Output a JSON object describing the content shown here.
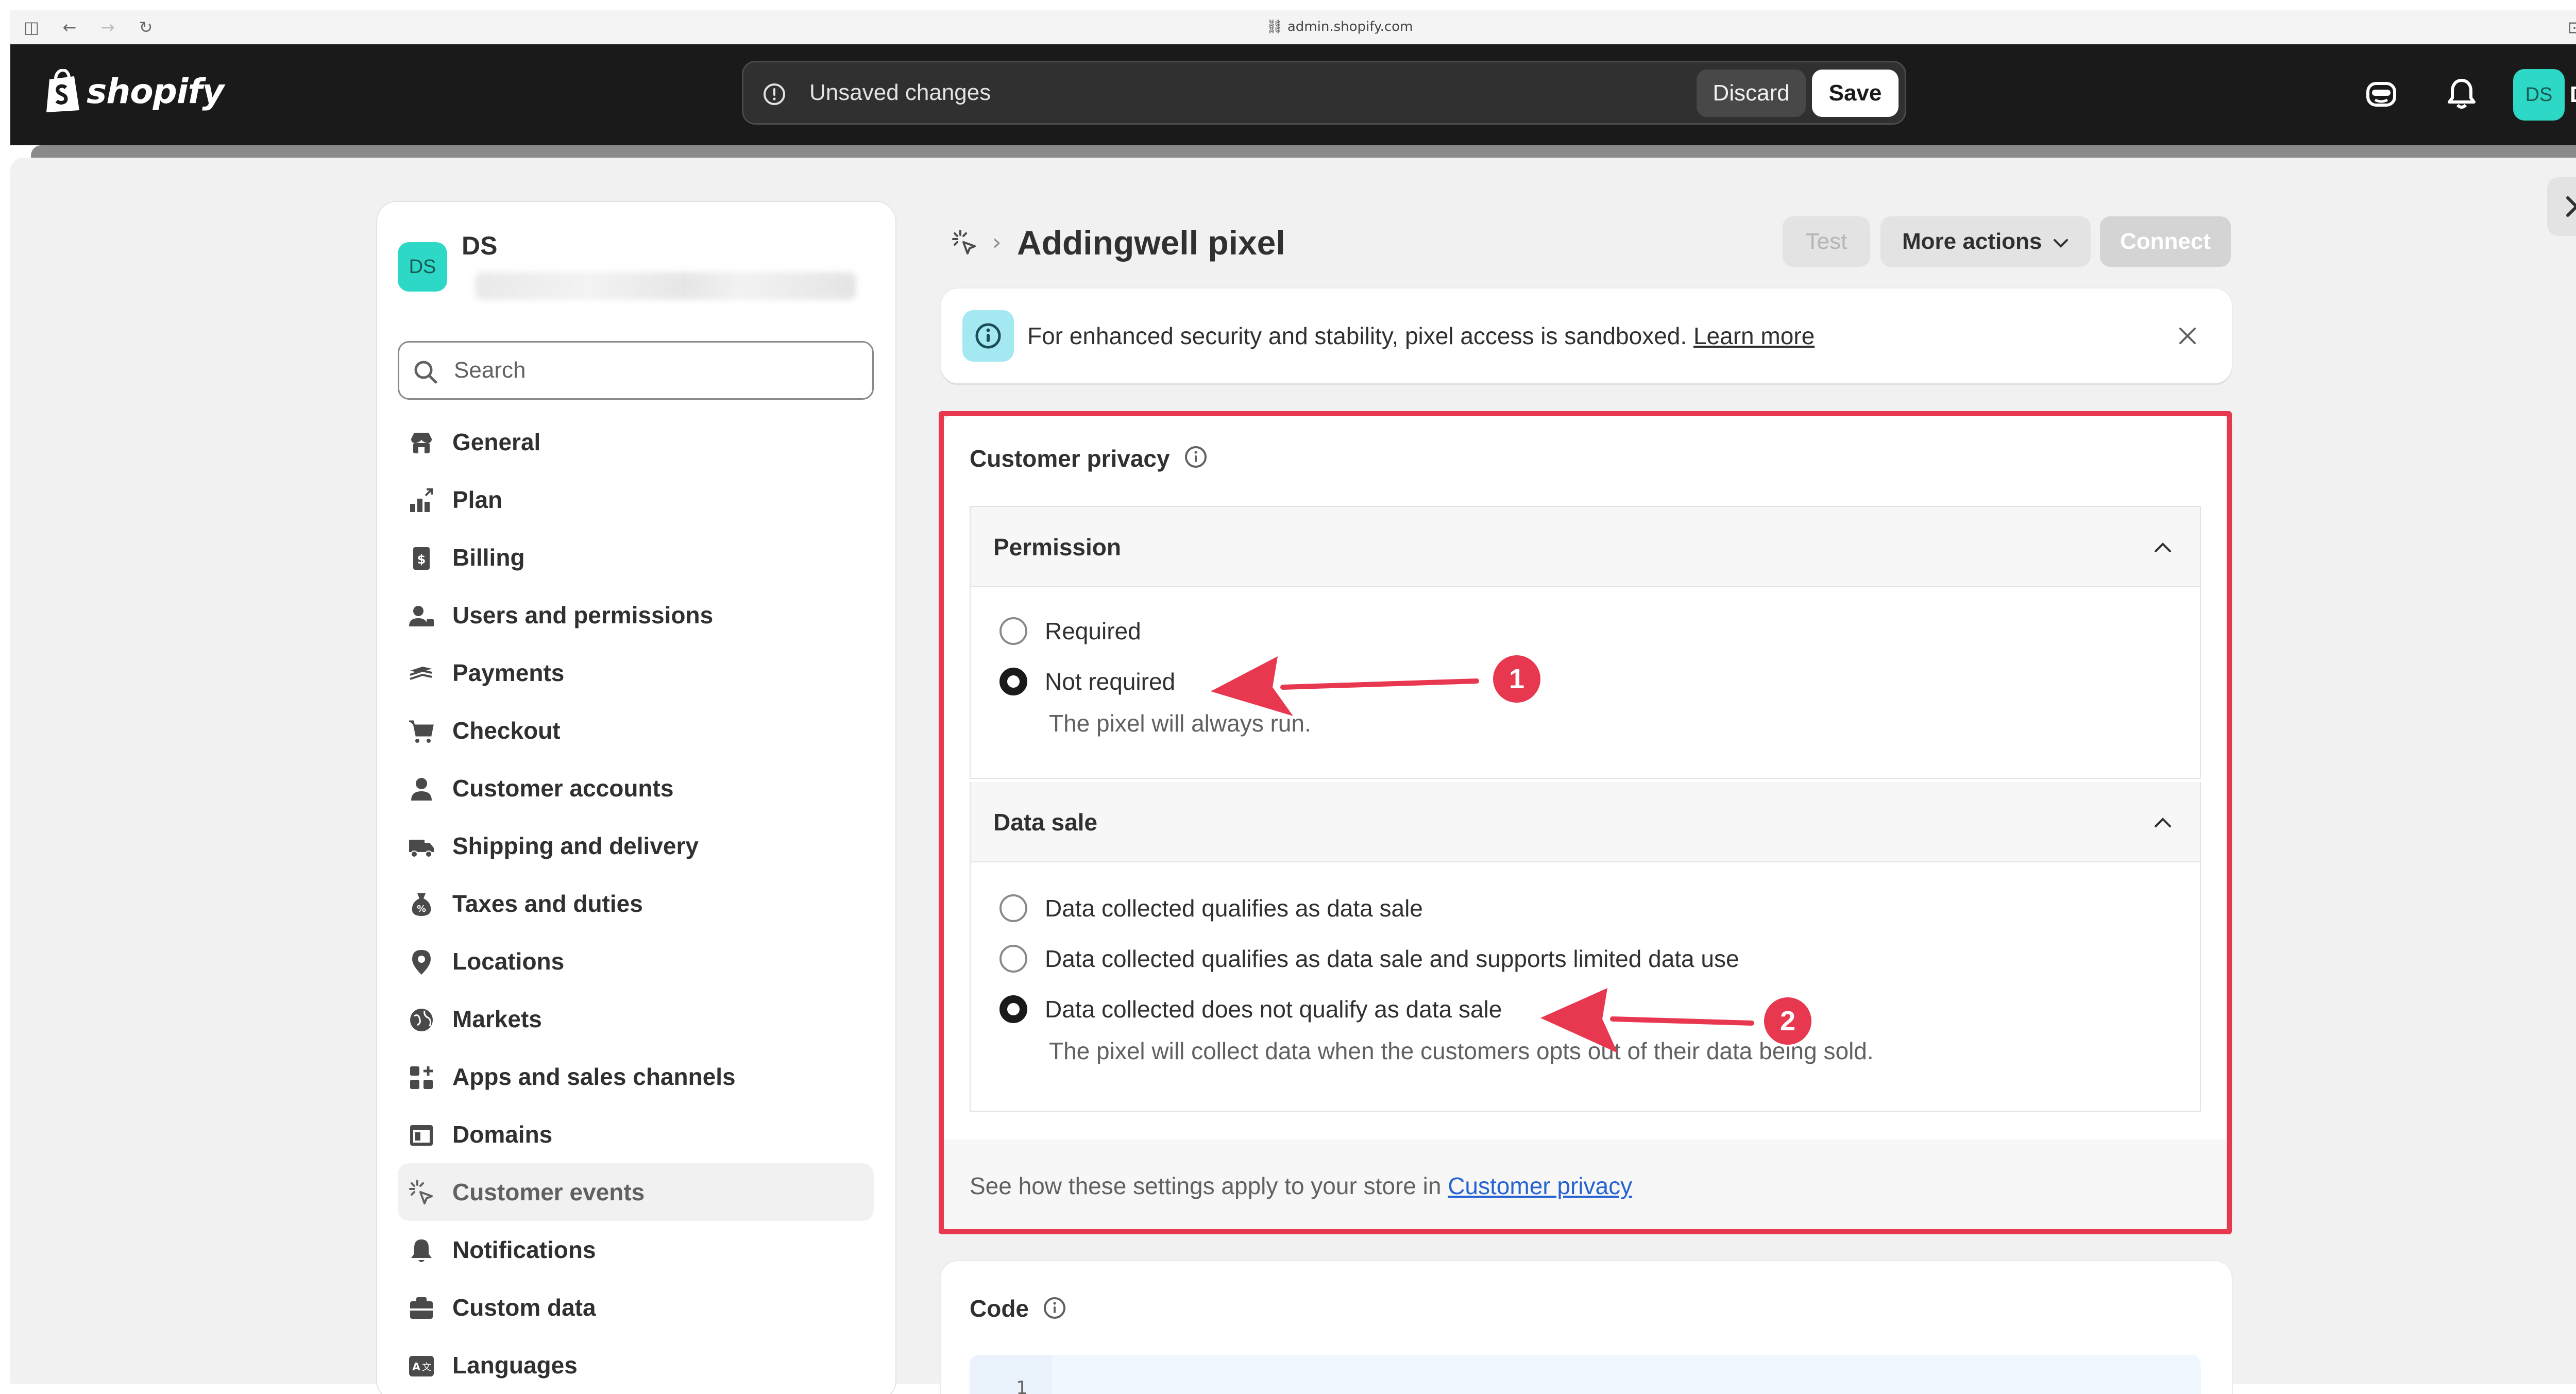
{
  "browser": {
    "url": "admin.shopify.com"
  },
  "topbar": {
    "brand": "shopify",
    "unsaved_message": "Unsaved changes",
    "discard_label": "Discard",
    "save_label": "Save",
    "user_initials": "DS",
    "user_name": "DS"
  },
  "sidebar": {
    "store_initials": "DS",
    "store_name": "DS",
    "search_placeholder": "Search",
    "items": [
      {
        "label": "General",
        "icon": "store-icon"
      },
      {
        "label": "Plan",
        "icon": "plan-icon"
      },
      {
        "label": "Billing",
        "icon": "billing-icon"
      },
      {
        "label": "Users and permissions",
        "icon": "users-icon"
      },
      {
        "label": "Payments",
        "icon": "payments-icon"
      },
      {
        "label": "Checkout",
        "icon": "cart-icon"
      },
      {
        "label": "Customer accounts",
        "icon": "person-icon"
      },
      {
        "label": "Shipping and delivery",
        "icon": "truck-icon"
      },
      {
        "label": "Taxes and duties",
        "icon": "taxes-icon"
      },
      {
        "label": "Locations",
        "icon": "location-icon"
      },
      {
        "label": "Markets",
        "icon": "globe-icon"
      },
      {
        "label": "Apps and sales channels",
        "icon": "apps-icon"
      },
      {
        "label": "Domains",
        "icon": "domains-icon"
      },
      {
        "label": "Customer events",
        "icon": "cursor-click-icon",
        "active": true
      },
      {
        "label": "Notifications",
        "icon": "bell-icon"
      },
      {
        "label": "Custom data",
        "icon": "custom-data-icon"
      },
      {
        "label": "Languages",
        "icon": "languages-icon"
      }
    ]
  },
  "main": {
    "title": "Addingwell pixel",
    "test_label": "Test",
    "more_actions_label": "More actions",
    "connect_label": "Connect",
    "banner": {
      "text": "For enhanced security and stability, pixel access is sandboxed.",
      "link": "Learn more"
    },
    "privacy": {
      "title": "Customer privacy",
      "permission": {
        "title": "Permission",
        "options": [
          "Required",
          "Not required"
        ],
        "selected": "Not required",
        "help": "The pixel will always run."
      },
      "data_sale": {
        "title": "Data sale",
        "options": [
          "Data collected qualifies as data sale",
          "Data collected qualifies as data sale and supports limited data use",
          "Data collected does not qualify as data sale"
        ],
        "selected": "Data collected does not qualify as data sale",
        "help": "The pixel will collect data when the customers opts out of their data being sold."
      },
      "footer_text": "See how these settings apply to your store in",
      "footer_link": "Customer privacy"
    },
    "code": {
      "title": "Code",
      "line_number": "1"
    }
  },
  "annotations": {
    "badge_1": "1",
    "badge_2": "2",
    "color": "#e8384f"
  }
}
